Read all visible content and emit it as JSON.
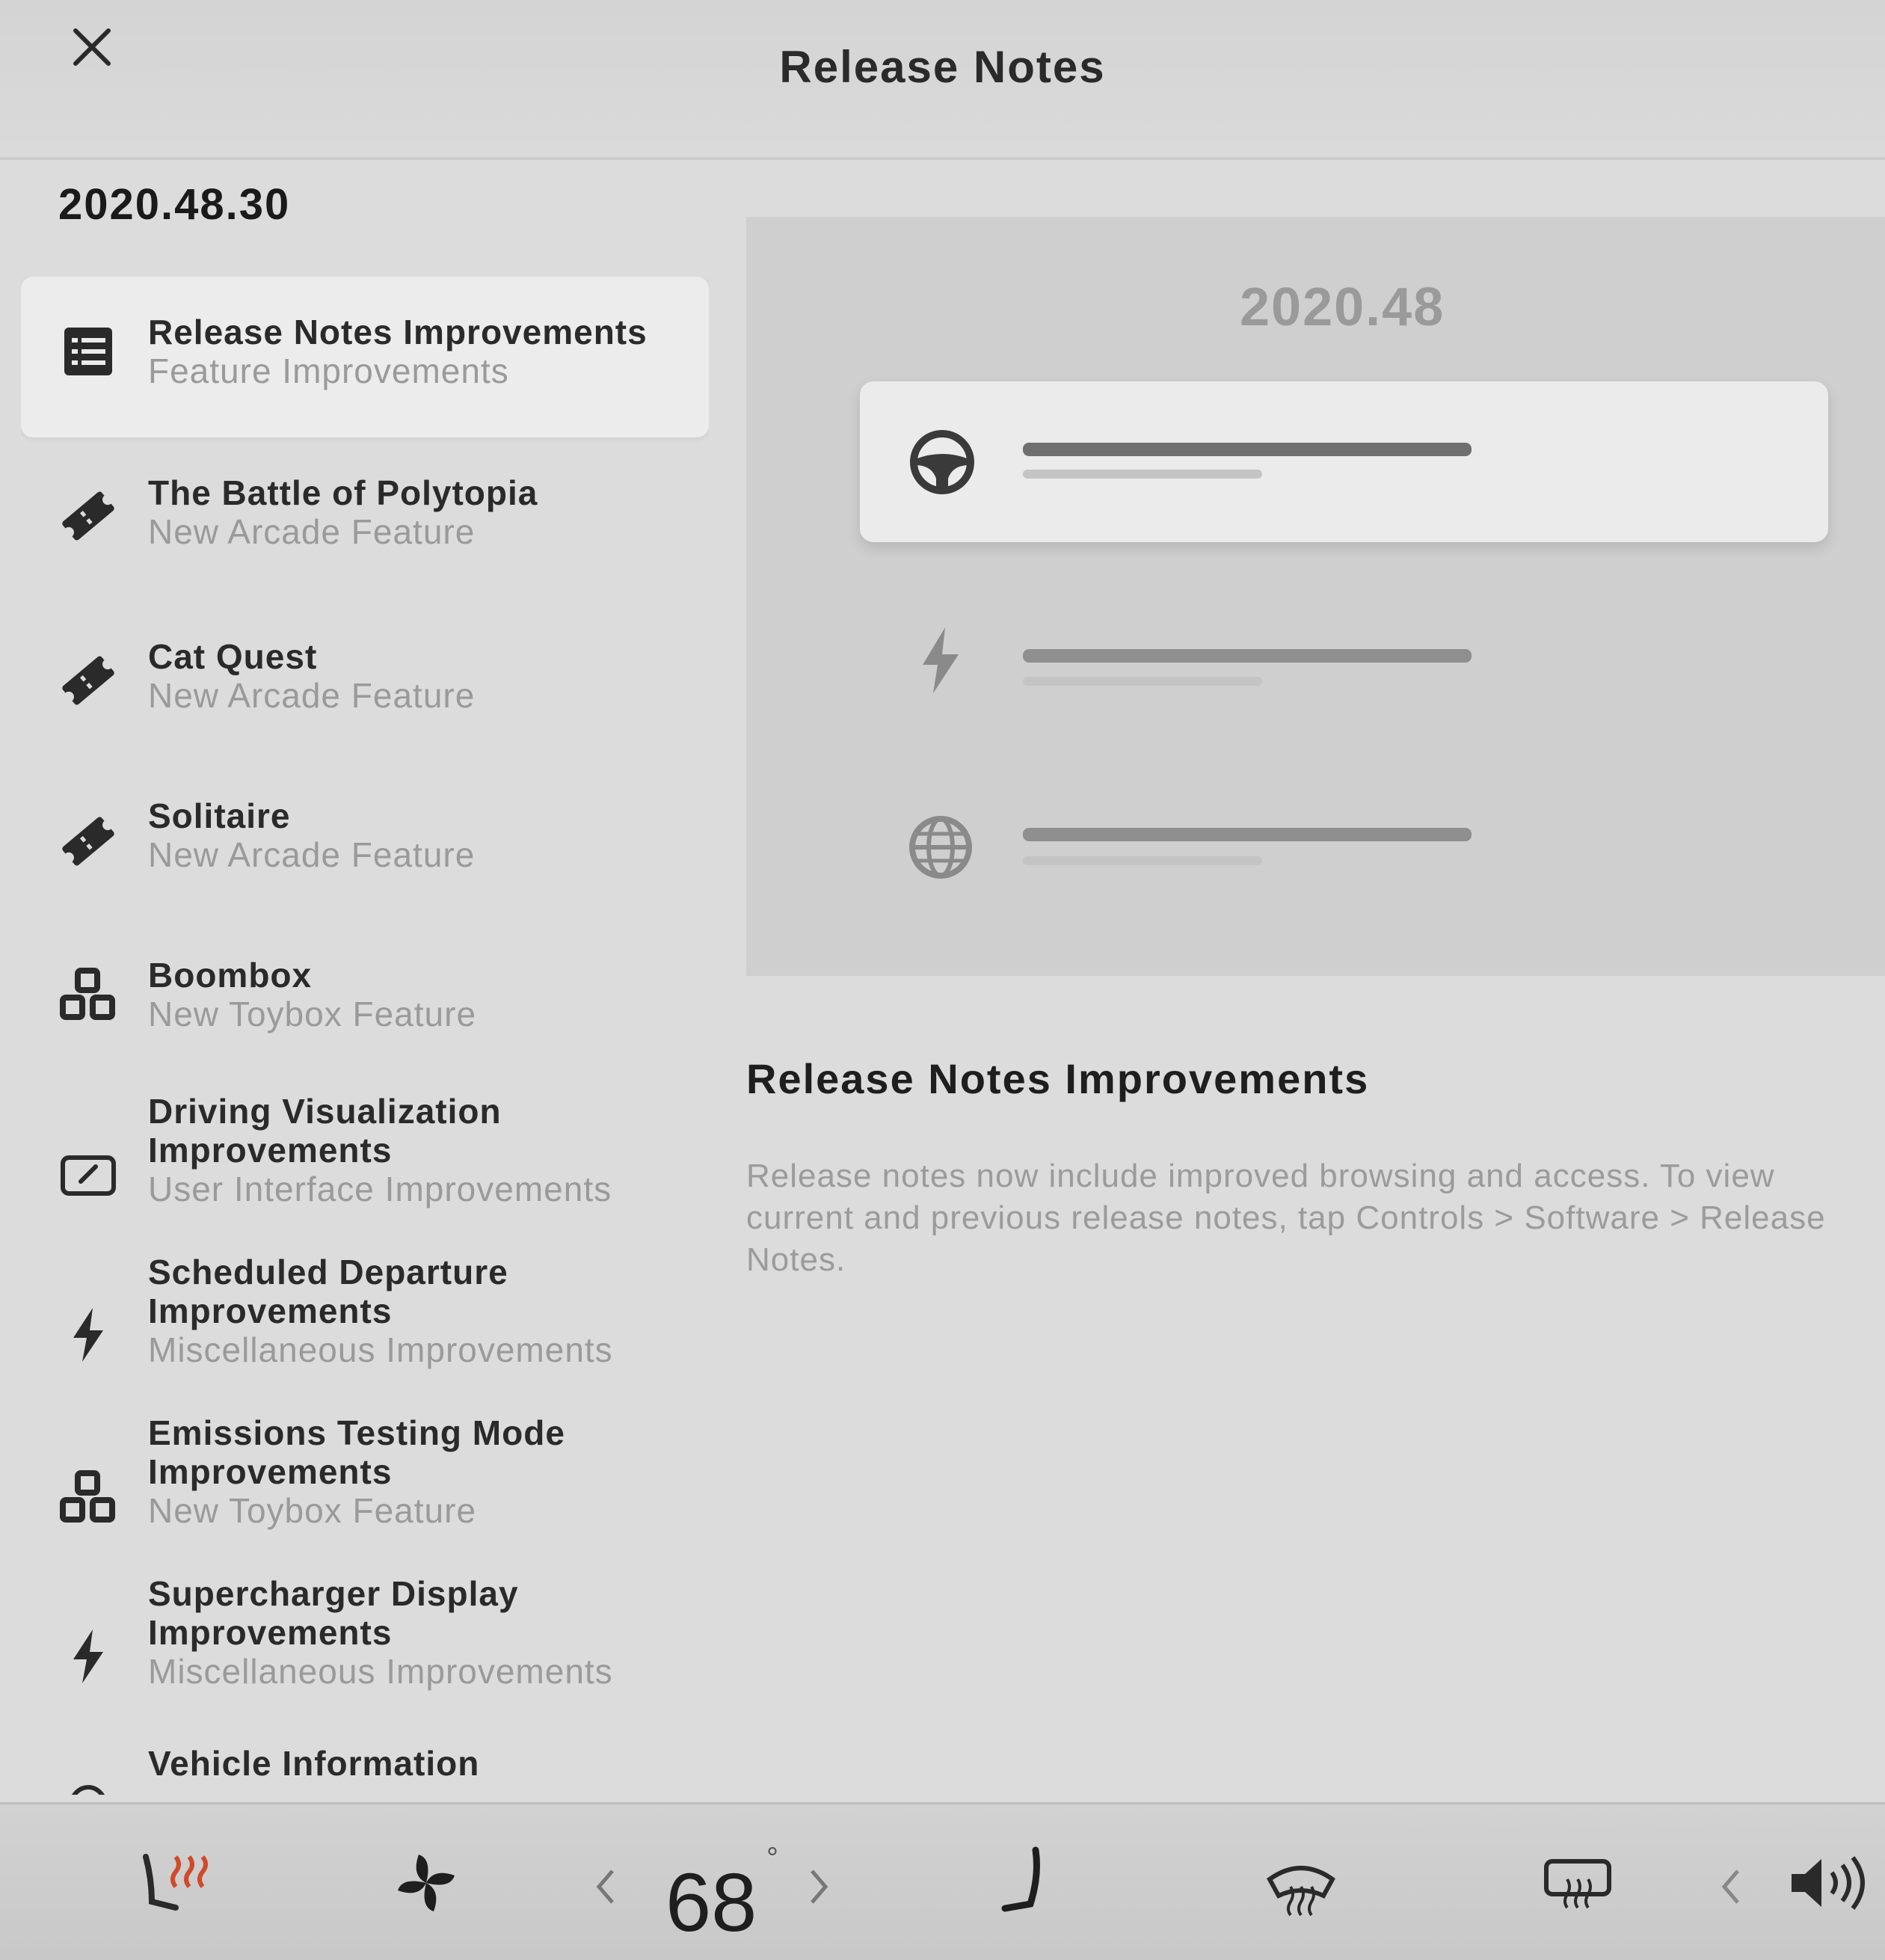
{
  "header": {
    "title": "Release Notes"
  },
  "version": "2020.48.30",
  "sidebar": {
    "items": [
      {
        "title": "Release Notes Improvements",
        "subtitle": "Feature Improvements",
        "icon": "list-icon"
      },
      {
        "title": "The Battle of Polytopia",
        "subtitle": "New Arcade Feature",
        "icon": "ticket-icon"
      },
      {
        "title": "Cat Quest",
        "subtitle": "New Arcade Feature",
        "icon": "ticket-icon"
      },
      {
        "title": "Solitaire",
        "subtitle": "New Arcade Feature",
        "icon": "ticket-icon"
      },
      {
        "title": "Boombox",
        "subtitle": "New Toybox Feature",
        "icon": "blocks-icon"
      },
      {
        "title": "Driving Visualization Improvements",
        "subtitle": "User Interface Improvements",
        "icon": "display-icon"
      },
      {
        "title": "Scheduled Departure Improvements",
        "subtitle": "Miscellaneous Improvements",
        "icon": "bolt-icon"
      },
      {
        "title": "Emissions Testing Mode Improvements",
        "subtitle": "New Toybox Feature",
        "icon": "blocks-icon"
      },
      {
        "title": "Supercharger Display Improvements",
        "subtitle": "Miscellaneous Improvements",
        "icon": "bolt-icon"
      },
      {
        "title": "Vehicle Information",
        "subtitle": "",
        "icon": "car-icon"
      }
    ]
  },
  "preview": {
    "version": "2020.48"
  },
  "detail": {
    "title": "Release Notes Improvements",
    "body": "Release notes now include improved browsing and access. To view current and previous release notes, tap Controls > Software > Release Notes."
  },
  "climate": {
    "temperature": "68",
    "degree": "°"
  }
}
